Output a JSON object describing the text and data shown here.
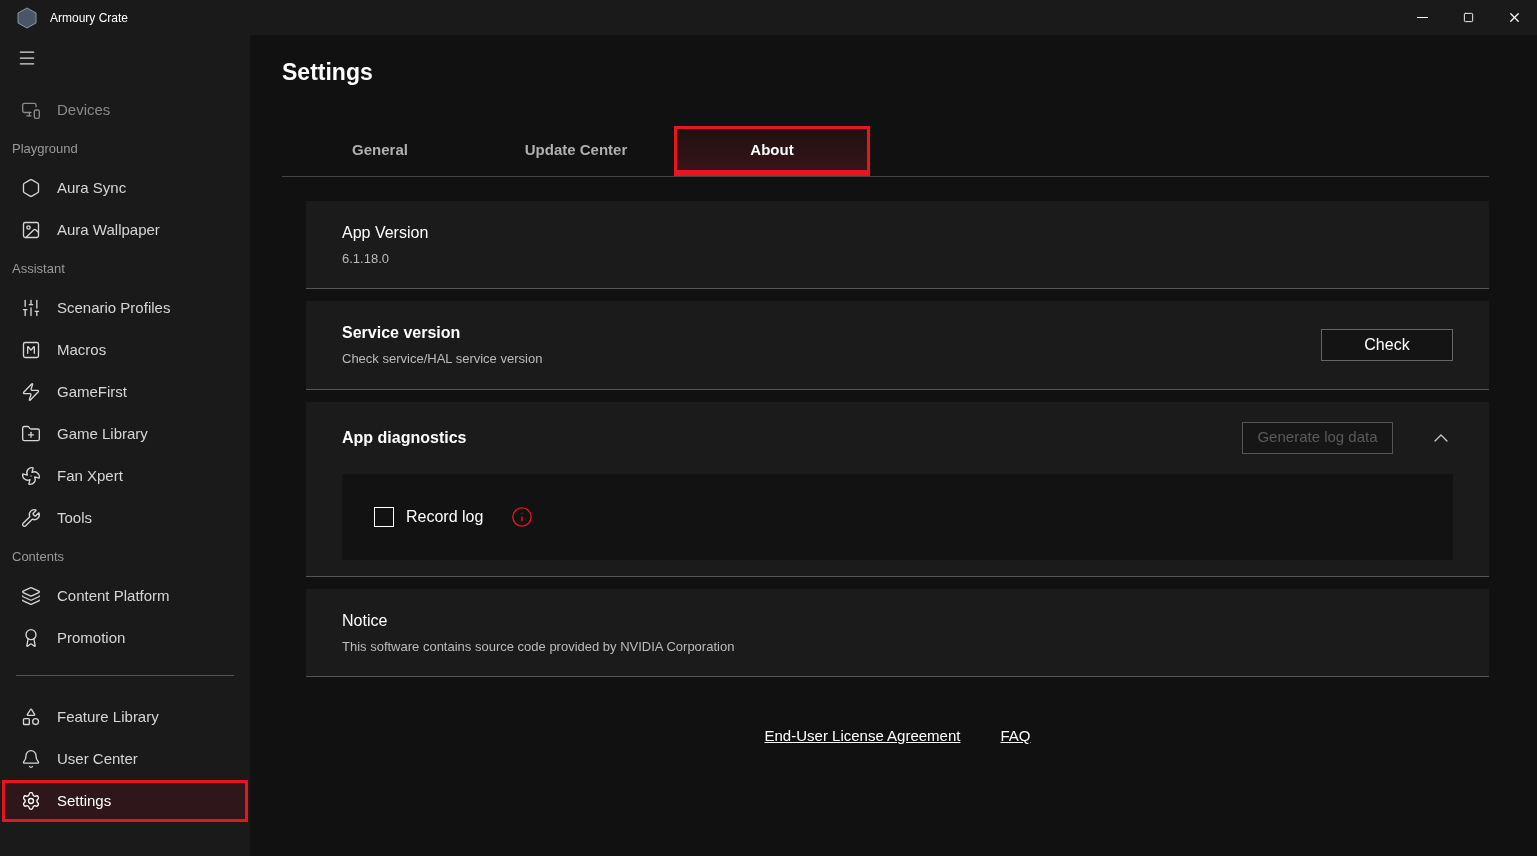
{
  "window": {
    "title": "Armoury Crate"
  },
  "sidebar": {
    "items": [
      {
        "kind": "item",
        "label": "Devices",
        "disabled": true,
        "selected": false
      },
      {
        "kind": "section",
        "label": "Playground"
      },
      {
        "kind": "item",
        "label": "Aura Sync",
        "disabled": false,
        "selected": false
      },
      {
        "kind": "item",
        "label": "Aura Wallpaper",
        "disabled": false,
        "selected": false
      },
      {
        "kind": "section",
        "label": "Assistant"
      },
      {
        "kind": "item",
        "label": "Scenario Profiles",
        "disabled": false,
        "selected": false
      },
      {
        "kind": "item",
        "label": "Macros",
        "disabled": false,
        "selected": false
      },
      {
        "kind": "item",
        "label": "GameFirst",
        "disabled": false,
        "selected": false
      },
      {
        "kind": "item",
        "label": "Game Library",
        "disabled": false,
        "selected": false
      },
      {
        "kind": "item",
        "label": "Fan Xpert",
        "disabled": false,
        "selected": false
      },
      {
        "kind": "item",
        "label": "Tools",
        "disabled": false,
        "selected": false
      },
      {
        "kind": "section",
        "label": "Contents"
      },
      {
        "kind": "item",
        "label": "Content Platform",
        "disabled": false,
        "selected": false
      },
      {
        "kind": "item",
        "label": "Promotion",
        "disabled": false,
        "selected": false
      }
    ],
    "bottom_items": [
      {
        "label": "Feature Library",
        "selected": false
      },
      {
        "label": "User Center",
        "selected": false
      },
      {
        "label": "Settings",
        "selected": true
      }
    ]
  },
  "page": {
    "title": "Settings",
    "tabs": [
      {
        "label": "General",
        "selected": false
      },
      {
        "label": "Update Center",
        "selected": false
      },
      {
        "label": "About",
        "selected": true
      }
    ],
    "app_version": {
      "title": "App Version",
      "value": "6.1.18.0"
    },
    "service_version": {
      "title": "Service version",
      "description": "Check service/HAL service version",
      "button": "Check"
    },
    "diagnostics": {
      "title": "App diagnostics",
      "button": "Generate log data",
      "button_disabled": true,
      "expanded": true,
      "record_log": {
        "label": "Record log",
        "checked": false
      }
    },
    "notice": {
      "title": "Notice",
      "text": "This software contains source code provided by NVIDIA Corporation"
    },
    "links": [
      "End-User License Agreement",
      "FAQ"
    ]
  }
}
